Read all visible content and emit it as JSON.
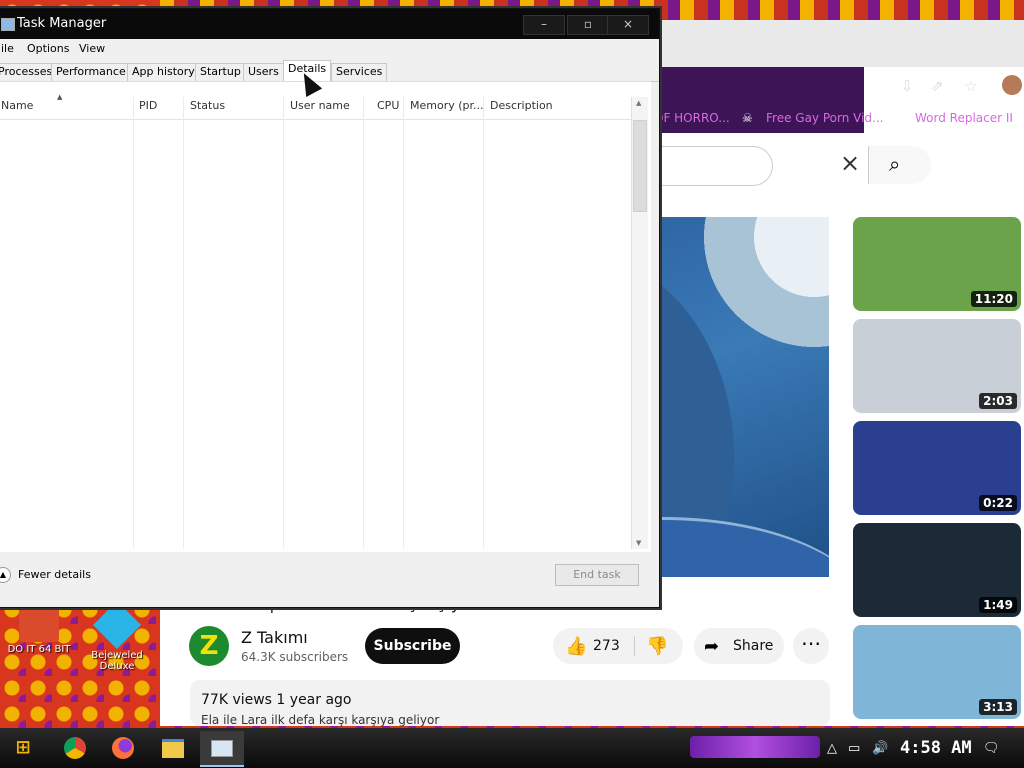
{
  "task_manager": {
    "title": "Task Manager",
    "window_buttons": {
      "minimize": "–",
      "maximize": "▫",
      "close": "×"
    },
    "menu": [
      "ile",
      "Options",
      "View"
    ],
    "tabs": [
      "Processes",
      "Performance",
      "App history",
      "Startup",
      "Users",
      "Details",
      "Services"
    ],
    "active_tab": "Details",
    "columns": [
      "Name",
      "PID",
      "Status",
      "User name",
      "CPU",
      "Memory (pr...",
      "Description"
    ],
    "fewer_details": "Fewer details",
    "end_task": "End task"
  },
  "browser": {
    "bookmarks": [
      "OF HORRO...",
      "Free Gay Porn Vid...",
      "Word Replacer II"
    ],
    "video": {
      "title_partial": "Z TAKIMI | Ela ve Lara Karşılaşıyor",
      "channel_name": "Z Takımı",
      "channel_subs": "64.3K subscribers",
      "avatar_letter": "Z",
      "subscribe": "Subscribe",
      "likes": "273",
      "share": "Share",
      "more": "⋯",
      "views_line": "77K views  1 year ago",
      "description": "Ela ile Lara ilk defa karşı karşıya geliyor"
    },
    "recommendations": [
      {
        "duration": "11:20",
        "color": "#6aa34a"
      },
      {
        "duration": "2:03",
        "color": "#c9cfd6"
      },
      {
        "duration": "0:22",
        "color": "#2a3f8f"
      },
      {
        "duration": "1:49",
        "color": "#1c2a38"
      },
      {
        "duration": "3:13",
        "color": "#7fb6d8"
      }
    ]
  },
  "desktop_icons": [
    {
      "label": "DO IT 64 BIT"
    },
    {
      "label": "Bejeweled Deluxe"
    }
  ],
  "taskbar": {
    "clock": "4:58 AM"
  }
}
